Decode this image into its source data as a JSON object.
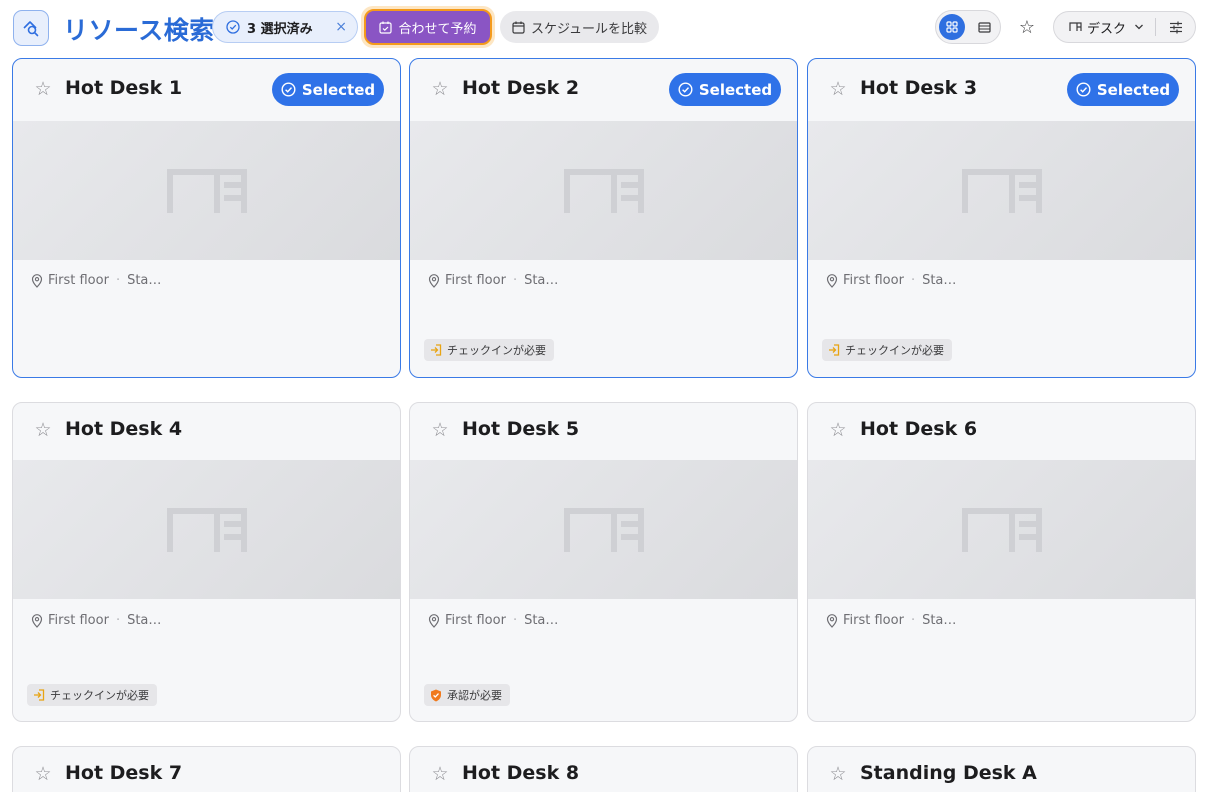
{
  "header": {
    "title": "リソース検索",
    "selection_count_label": "3 選択済み",
    "clear_selection": "×",
    "reserve_together": "合わせて予約",
    "compare_schedules": "スケジュールを比較",
    "resource_type": "デスク"
  },
  "colors": {
    "accent": "#2f72e8",
    "reserve_button": "#8a55c4",
    "highlight_outline": "#f49a1b"
  },
  "icons": {
    "app": "search-resource-icon",
    "check": "check-circle-icon",
    "calendar_check": "calendar-check-icon",
    "calendar": "calendar-icon",
    "grid_view": "grid-view-icon",
    "list_view": "list-view-icon",
    "favorite": "star-icon",
    "desk": "desk-icon",
    "chevron": "chevron-down-icon",
    "filter": "filter-sliders-icon",
    "location": "location-pin-icon",
    "check_in": "check-in-icon",
    "approval": "shield-icon"
  },
  "cards": [
    {
      "title": "Hot Desk 1",
      "selected_label": "Selected",
      "location": "First floor",
      "sep": "·",
      "extra": "Sta…",
      "tag": ""
    },
    {
      "title": "Hot Desk 2",
      "selected_label": "Selected",
      "location": "First floor",
      "sep": "·",
      "extra": "Sta…",
      "tag": "チェックインが必要"
    },
    {
      "title": "Hot Desk 3",
      "selected_label": "Selected",
      "location": "First floor",
      "sep": "·",
      "extra": "Sta…",
      "tag": "チェックインが必要"
    },
    {
      "title": "Hot Desk 4",
      "selected_label": "",
      "location": "First floor",
      "sep": "·",
      "extra": "Sta…",
      "tag": "チェックインが必要"
    },
    {
      "title": "Hot Desk 5",
      "selected_label": "",
      "location": "First floor",
      "sep": "·",
      "extra": "Sta…",
      "tag": "承認が必要"
    },
    {
      "title": "Hot Desk 6",
      "selected_label": "",
      "location": "First floor",
      "sep": "·",
      "extra": "Sta…",
      "tag": ""
    },
    {
      "title": "Hot Desk 7",
      "selected_label": "",
      "location": "",
      "sep": "",
      "extra": "",
      "tag": ""
    },
    {
      "title": "Hot Desk 8",
      "selected_label": "",
      "location": "",
      "sep": "",
      "extra": "",
      "tag": ""
    },
    {
      "title": "Standing Desk A",
      "selected_label": "",
      "location": "",
      "sep": "",
      "extra": "",
      "tag": ""
    }
  ]
}
